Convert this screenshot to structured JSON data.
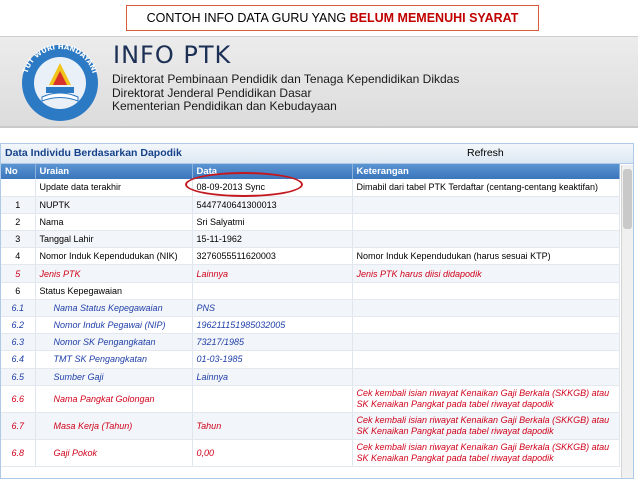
{
  "caption": {
    "prefix": "CONTOH INFO DATA GURU YANG ",
    "highlight": "BELUM MEMENUHI SYARAT"
  },
  "banner": {
    "title": "INFO PTK",
    "lines": [
      "Direktorat Pembinaan Pendidik dan Tenaga Kependidikan Dikdas",
      "Direktorat Jenderal Pendidikan Dasar",
      "Kementerian Pendidikan dan Kebudayaan"
    ],
    "logo_text": "TUT WURI HANDAYANI"
  },
  "panel": {
    "title": "Data Individu Berdasarkan Dapodik",
    "refresh_label": "Refresh",
    "columns": [
      "No",
      "Uraian",
      "Data",
      "Keterangan"
    ],
    "rows": [
      {
        "no": "",
        "uraian": "Update data terakhir",
        "data": "08-09-2013 Sync",
        "ket": "Dimabil dari tabel PTK Terdaftar (centang-centang keaktifan)",
        "style": "normal",
        "size": "norm"
      },
      {
        "no": "1",
        "uraian": "NUPTK",
        "data": "5447740641300013",
        "ket": "",
        "style": "normal",
        "size": "norm"
      },
      {
        "no": "2",
        "uraian": "Nama",
        "data": "Sri Salyatmi",
        "ket": "",
        "style": "normal",
        "size": "norm"
      },
      {
        "no": "3",
        "uraian": "Tanggal Lahir",
        "data": "15-11-1962",
        "ket": "",
        "style": "normal",
        "size": "norm"
      },
      {
        "no": "4",
        "uraian": "Nomor Induk Kependudukan (NIK)",
        "data": "3276055511620003",
        "ket": "Nomor Induk Kependudukan (harus sesuai KTP)",
        "style": "normal",
        "size": "norm"
      },
      {
        "no": "5",
        "uraian": "Jenis PTK",
        "data": "Lainnya",
        "ket": "Jenis PTK harus diisi didapodik",
        "style": "red",
        "size": "norm"
      },
      {
        "no": "6",
        "uraian": "Status Kepegawaian",
        "data": "",
        "ket": "",
        "style": "normal",
        "size": "norm"
      },
      {
        "no": "6.1",
        "uraian": "Nama Status Kepegawaian",
        "data": "PNS",
        "ket": "",
        "style": "blue",
        "size": "norm",
        "indent": true
      },
      {
        "no": "6.2",
        "uraian": "Nomor Induk Pegawai (NIP)",
        "data": "196211151985032005",
        "ket": "",
        "style": "blue",
        "size": "norm",
        "indent": true
      },
      {
        "no": "6.3",
        "uraian": "Nomor SK Pengangkatan",
        "data": "73217/1985",
        "ket": "",
        "style": "blue",
        "size": "norm",
        "indent": true
      },
      {
        "no": "6.4",
        "uraian": "TMT SK Pengangkatan",
        "data": "01-03-1985",
        "ket": "",
        "style": "blue",
        "size": "norm",
        "indent": true
      },
      {
        "no": "6.5",
        "uraian": "Sumber Gaji",
        "data": "Lainnya",
        "ket": "",
        "style": "blue",
        "size": "norm",
        "indent": true
      },
      {
        "no": "6.6",
        "uraian": "Nama Pangkat Golongan",
        "data": "",
        "ket": "Cek kembali isian riwayat Kenaikan Gaji Berkala (SKKGB) atau SK Kenaikan Pangkat pada tabel riwayat dapodik",
        "style": "red",
        "size": "tall",
        "indent": true
      },
      {
        "no": "6.7",
        "uraian": "Masa Kerja (Tahun)",
        "data": "Tahun",
        "ket": "Cek kembali isian riwayat Kenaikan Gaji Berkala (SKKGB) atau SK Kenaikan Pangkat pada tabel riwayat dapodik",
        "style": "red",
        "size": "tall",
        "indent": true
      },
      {
        "no": "6.8",
        "uraian": "Gaji Pokok",
        "data": "0,00",
        "ket": "Cek kembali isian riwayat Kenaikan Gaji Berkala (SKKGB) atau SK Kenaikan Pangkat pada tabel riwayat dapodik",
        "style": "red",
        "size": "tall",
        "indent": true
      }
    ]
  },
  "colors": {
    "red_text": "#d0021b",
    "blue_text": "#1f3fa8",
    "header_blue": "#3b76bd",
    "highlight_ring": "#c4181f"
  }
}
